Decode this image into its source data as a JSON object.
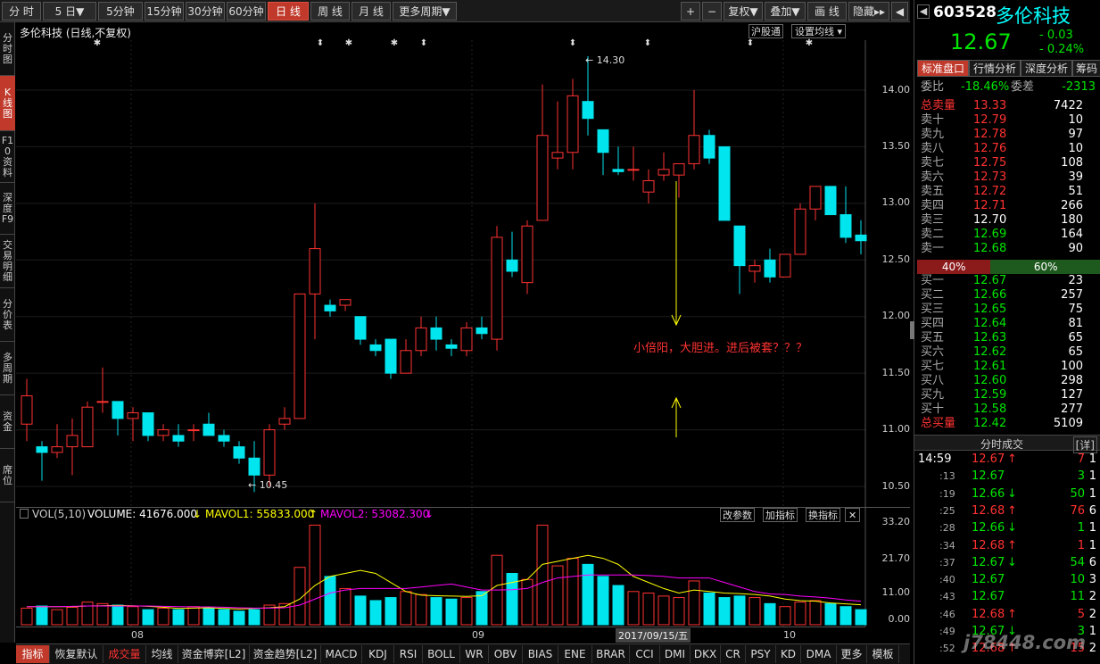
{
  "toolbar": {
    "periods": [
      "分 时",
      "5 日▼",
      "5分钟",
      "15分钟",
      "30分钟",
      "60分钟",
      "日 线",
      "周 线",
      "月 线",
      "更多周期▼"
    ],
    "right_tools": [
      "+",
      "−",
      "复权▼",
      "叠加▼",
      "画 线",
      "隐藏▸▸",
      "◀"
    ]
  },
  "sidebar": {
    "tabs": [
      "分时图",
      "K线图",
      "F10资料",
      "深度F9",
      "交易明细",
      "分价表",
      "多周期",
      "资金",
      "席位"
    ]
  },
  "chart": {
    "title": "多伦科技 (日线,不复权)",
    "hgt_btn": "沪股通",
    "ma_btn": "设置均线",
    "annotation_text": "小倍阳，大胆进。进后被套？？？",
    "high_label": "14.30",
    "low_label": "10.45",
    "price_ticks": [
      "14.00",
      "13.50",
      "13.00",
      "12.50",
      "12.00",
      "11.50",
      "11.00",
      "10.50"
    ],
    "vol_legend": {
      "name": "VOL(5,10)",
      "volume": "VOLUME: 41676.000",
      "ma1": "MAVOL1: 55833.000",
      "ma2": "MAVOL2: 53082.300"
    },
    "vol_btns": [
      "改参数",
      "加指标",
      "换指标",
      "✕"
    ],
    "vol_ticks": [
      "33.20",
      "21.70",
      "11.00",
      "0.00"
    ],
    "date_labels": [
      "08",
      "09",
      "10"
    ],
    "cursor_date": "2017/09/15/五"
  },
  "chart_data": {
    "type": "candlestick",
    "ylim": [
      10.3,
      14.5
    ],
    "candles": [
      [
        11.05,
        11.3,
        10.9,
        11.45
      ],
      [
        10.85,
        10.8,
        10.55,
        10.9
      ],
      [
        10.8,
        10.85,
        10.75,
        11.05
      ],
      [
        10.85,
        10.95,
        10.6,
        11.1
      ],
      [
        10.85,
        11.2,
        10.85,
        11.25
      ],
      [
        11.25,
        11.25,
        11.15,
        11.55
      ],
      [
        11.25,
        11.1,
        10.95,
        11.25
      ],
      [
        11.1,
        11.15,
        10.9,
        11.2
      ],
      [
        11.15,
        10.95,
        10.9,
        11.15
      ],
      [
        10.95,
        11.0,
        10.9,
        11.05
      ],
      [
        10.95,
        10.9,
        10.85,
        11.05
      ],
      [
        11.0,
        11.0,
        10.9,
        11.05
      ],
      [
        11.05,
        10.95,
        10.95,
        11.15
      ],
      [
        10.95,
        10.9,
        10.85,
        11.0
      ],
      [
        10.85,
        10.75,
        10.7,
        10.9
      ],
      [
        10.75,
        10.6,
        10.45,
        10.9
      ],
      [
        10.6,
        11.0,
        10.5,
        11.05
      ],
      [
        11.05,
        11.1,
        11.0,
        11.2
      ],
      [
        11.1,
        12.2,
        11.1,
        12.2
      ],
      [
        12.2,
        12.6,
        11.8,
        13.0
      ],
      [
        12.1,
        12.05,
        12.0,
        12.15
      ],
      [
        12.1,
        12.15,
        12.05,
        12.15
      ],
      [
        12.0,
        11.8,
        11.75,
        12.0
      ],
      [
        11.75,
        11.7,
        11.65,
        11.8
      ],
      [
        11.8,
        11.5,
        11.45,
        11.8
      ],
      [
        11.5,
        11.7,
        11.5,
        11.8
      ],
      [
        11.7,
        11.9,
        11.65,
        12.0
      ],
      [
        11.9,
        11.8,
        11.7,
        12.0
      ],
      [
        11.75,
        11.72,
        11.65,
        11.8
      ],
      [
        11.7,
        11.9,
        11.65,
        11.95
      ],
      [
        11.9,
        11.85,
        11.8,
        12.0
      ],
      [
        11.8,
        12.7,
        11.7,
        12.8
      ],
      [
        12.5,
        12.4,
        12.35,
        12.75
      ],
      [
        12.3,
        12.8,
        12.2,
        12.85
      ],
      [
        12.85,
        13.6,
        12.85,
        14.05
      ],
      [
        13.4,
        13.45,
        13.3,
        13.9
      ],
      [
        13.45,
        13.95,
        13.3,
        14.1
      ],
      [
        13.9,
        13.75,
        13.6,
        14.3
      ],
      [
        13.65,
        13.45,
        13.25,
        13.65
      ],
      [
        13.3,
        13.28,
        13.25,
        13.5
      ],
      [
        13.3,
        13.3,
        13.2,
        13.5
      ],
      [
        13.1,
        13.2,
        13.0,
        13.3
      ],
      [
        13.25,
        13.3,
        13.2,
        13.45
      ],
      [
        13.25,
        13.35,
        13.05,
        13.35
      ],
      [
        13.35,
        13.6,
        13.3,
        14.0
      ],
      [
        13.6,
        13.4,
        13.35,
        13.65
      ],
      [
        13.5,
        12.85,
        12.85,
        13.5
      ],
      [
        12.8,
        12.45,
        12.2,
        12.8
      ],
      [
        12.4,
        12.45,
        12.3,
        12.5
      ],
      [
        12.5,
        12.35,
        12.3,
        12.6
      ],
      [
        12.35,
        12.55,
        12.35,
        12.55
      ],
      [
        12.55,
        12.95,
        12.55,
        13.0
      ],
      [
        12.95,
        13.15,
        12.85,
        13.15
      ],
      [
        13.15,
        12.9,
        12.9,
        13.15
      ],
      [
        12.9,
        12.7,
        12.65,
        13.15
      ],
      [
        12.72,
        12.67,
        12.55,
        12.85
      ]
    ],
    "volumes": [
      5.5,
      6.2,
      5.0,
      5.8,
      7.5,
      7.0,
      6.5,
      6.0,
      5.0,
      5.5,
      5.0,
      6.0,
      5.5,
      5.0,
      4.5,
      5.0,
      6.5,
      7.0,
      19.0,
      33.0,
      16.0,
      12.0,
      9.5,
      8.0,
      9.0,
      11.0,
      10.0,
      9.0,
      8.5,
      9.0,
      11.0,
      23.0,
      17.0,
      15.0,
      33.0,
      19.5,
      22.0,
      20.0,
      16.0,
      13.0,
      11.0,
      10.5,
      9.5,
      9.0,
      14.5,
      10.5,
      9.0,
      9.5,
      9.0,
      7.0,
      6.0,
      7.5,
      8.0,
      7.0,
      6.0,
      5.0
    ],
    "mavol1": [
      6.0,
      6.0,
      6.0,
      6.0,
      6.2,
      6.3,
      6.4,
      6.3,
      6.1,
      5.8,
      5.4,
      5.5,
      5.6,
      5.4,
      5.2,
      5.4,
      5.6,
      6.0,
      8.5,
      13.0,
      16.0,
      17.0,
      18.0,
      17.0,
      14.0,
      11.0,
      9.8,
      9.6,
      9.5,
      9.4,
      9.6,
      13.0,
      14.0,
      15.0,
      20.0,
      21.0,
      22.0,
      23.0,
      22.0,
      20.0,
      16.0,
      14.0,
      12.0,
      10.5,
      11.5,
      11.0,
      10.5,
      10.3,
      10.0,
      9.5,
      8.5,
      8.0,
      7.8,
      7.2,
      6.9,
      6.6
    ],
    "mavol2": [
      6.0,
      6.0,
      6.0,
      6.1,
      6.2,
      6.2,
      6.2,
      6.2,
      6.2,
      6.1,
      6.0,
      5.9,
      5.9,
      5.8,
      5.6,
      5.5,
      5.5,
      5.6,
      6.5,
      8.5,
      10.5,
      11.5,
      12.0,
      12.0,
      12.0,
      12.0,
      12.5,
      13.0,
      13.5,
      12.5,
      11.5,
      11.5,
      11.6,
      12.0,
      14.0,
      15.5,
      16.0,
      16.5,
      16.5,
      16.5,
      16.5,
      16.3,
      16.0,
      15.5,
      15.5,
      15.5,
      14.0,
      12.5,
      11.0,
      10.2,
      10.0,
      9.5,
      9.2,
      8.8,
      8.2,
      7.8
    ],
    "vol_ylim": [
      0,
      34.0
    ]
  },
  "stock": {
    "code": "603528",
    "name": "多伦科技",
    "price": "12.67",
    "change": "- 0.03",
    "pct": "- 0.24%"
  },
  "panel_tabs": [
    "标准盘口",
    "行情分析",
    "深度分析",
    "筹码"
  ],
  "ratio": {
    "wb_label": "委比",
    "wb_val": "-18.46%",
    "wc_label": "委差",
    "wc_val": "-2313"
  },
  "total_sell": {
    "label": "总卖量",
    "price": "13.33",
    "vol": "7422"
  },
  "asks": [
    {
      "label": "卖十",
      "price": "12.79",
      "vol": "10"
    },
    {
      "label": "卖九",
      "price": "12.78",
      "vol": "97"
    },
    {
      "label": "卖八",
      "price": "12.76",
      "vol": "10"
    },
    {
      "label": "卖七",
      "price": "12.75",
      "vol": "108"
    },
    {
      "label": "卖六",
      "price": "12.73",
      "vol": "39"
    },
    {
      "label": "卖五",
      "price": "12.72",
      "vol": "51"
    },
    {
      "label": "卖四",
      "price": "12.71",
      "vol": "266"
    },
    {
      "label": "卖三",
      "price": "12.70",
      "vol": "180"
    },
    {
      "label": "卖二",
      "price": "12.69",
      "vol": "164"
    },
    {
      "label": "卖一",
      "price": "12.68",
      "vol": "90"
    }
  ],
  "bar": {
    "left": "40%",
    "right": "60%",
    "left_frac": 0.4
  },
  "bids": [
    {
      "label": "买一",
      "price": "12.67",
      "vol": "23"
    },
    {
      "label": "买二",
      "price": "12.66",
      "vol": "257"
    },
    {
      "label": "买三",
      "price": "12.65",
      "vol": "75"
    },
    {
      "label": "买四",
      "price": "12.64",
      "vol": "81"
    },
    {
      "label": "买五",
      "price": "12.63",
      "vol": "65"
    },
    {
      "label": "买六",
      "price": "12.62",
      "vol": "65"
    },
    {
      "label": "买七",
      "price": "12.61",
      "vol": "100"
    },
    {
      "label": "买八",
      "price": "12.60",
      "vol": "298"
    },
    {
      "label": "买九",
      "price": "12.59",
      "vol": "127"
    },
    {
      "label": "买十",
      "price": "12.58",
      "vol": "277"
    }
  ],
  "total_buy": {
    "label": "总买量",
    "price": "12.42",
    "vol": "5109"
  },
  "trades_header": {
    "title": "分时成交",
    "detail": "[详]"
  },
  "trades": [
    {
      "time": "14:59",
      "price": "12.67",
      "dir": "↑",
      "vol": "7",
      "n": "1"
    },
    {
      "time": ":13",
      "price": "12.67",
      "dir": "",
      "vol": "3",
      "n": "1"
    },
    {
      "time": ":19",
      "price": "12.66",
      "dir": "↓",
      "vol": "50",
      "n": "1"
    },
    {
      "time": ":25",
      "price": "12.68",
      "dir": "↑",
      "vol": "76",
      "n": "6"
    },
    {
      "time": ":28",
      "price": "12.66",
      "dir": "↓",
      "vol": "1",
      "n": "1"
    },
    {
      "time": ":34",
      "price": "12.68",
      "dir": "↑",
      "vol": "1",
      "n": "1"
    },
    {
      "time": ":37",
      "price": "12.67",
      "dir": "↓",
      "vol": "54",
      "n": "6"
    },
    {
      "time": ":40",
      "price": "12.67",
      "dir": "",
      "vol": "10",
      "n": "3"
    },
    {
      "time": ":43",
      "price": "12.67",
      "dir": "",
      "vol": "11",
      "n": "2"
    },
    {
      "time": ":46",
      "price": "12.68",
      "dir": "↑",
      "vol": "5",
      "n": "2"
    },
    {
      "time": ":49",
      "price": "12.67",
      "dir": "↓",
      "vol": "3",
      "n": "1"
    },
    {
      "time": ":52",
      "price": "12.68",
      "dir": "↑",
      "vol": "15",
      "n": "2"
    }
  ],
  "watermark": "j78448.com",
  "bottom_tabs": [
    "指标",
    "恢复默认",
    "成交量",
    "均线",
    "资金博弈[L2]",
    "资金趋势[L2]",
    "MACD",
    "KDJ",
    "RSI",
    "BOLL",
    "WR",
    "OBV",
    "BIAS",
    "ENE",
    "BRAR",
    "CCI",
    "DMI",
    "DKX",
    "CR",
    "PSY",
    "KD",
    "DMA",
    "更多",
    "模板"
  ],
  "colors": {
    "up": "#ff3232",
    "down": "#00e5ee",
    "ma1": "#ffff00",
    "ma2": "#ff00ff",
    "bg": "#000000",
    "active_tab": "#c0392b"
  }
}
